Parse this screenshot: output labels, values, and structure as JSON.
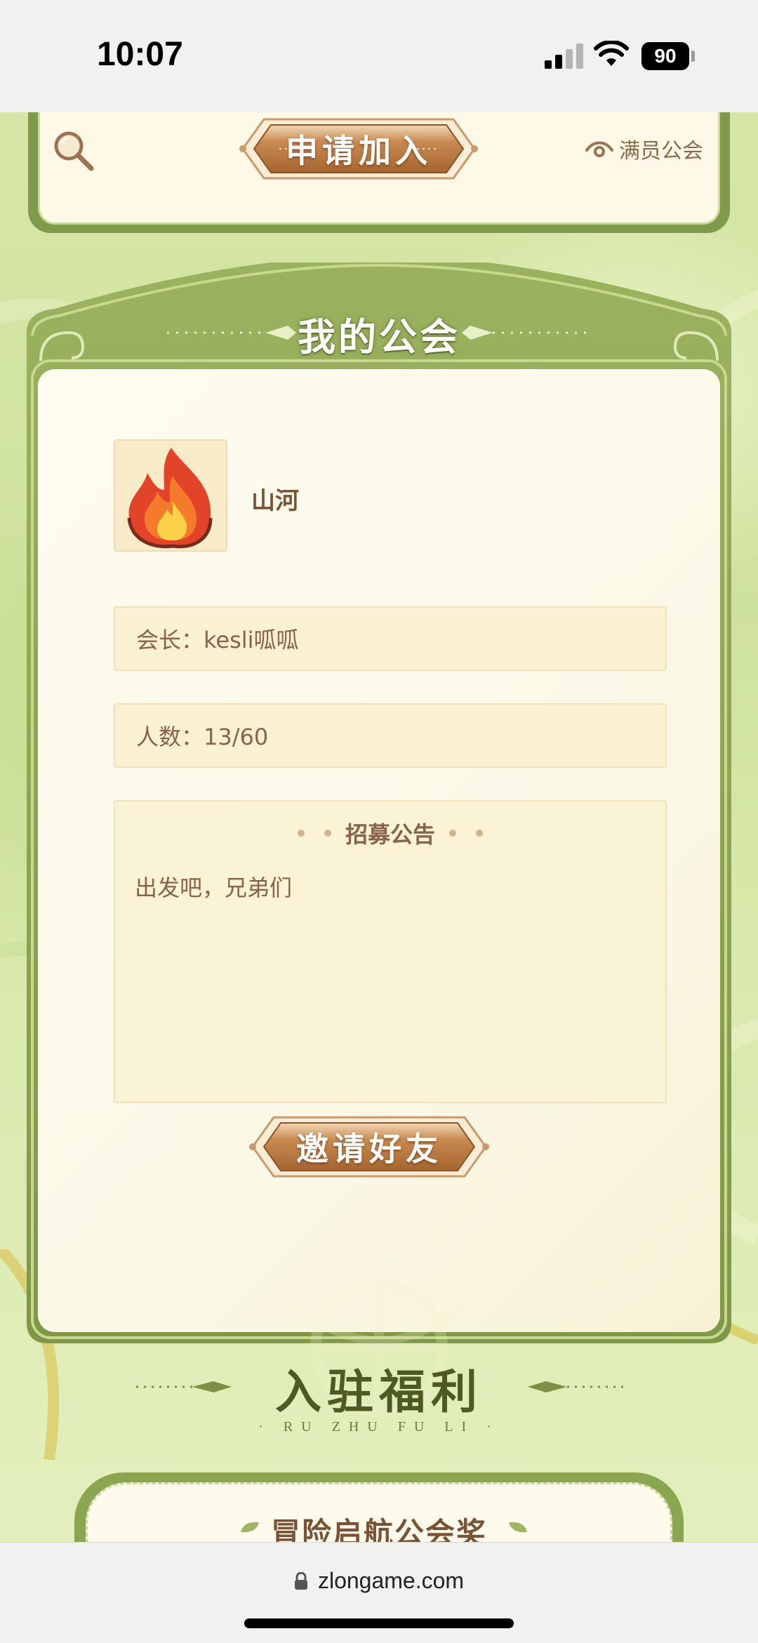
{
  "status_bar": {
    "time": "10:07",
    "battery": "90"
  },
  "top_card": {
    "apply_button": "申请加入",
    "view_full_label": "满员公会"
  },
  "my_guild": {
    "title": "我的公会",
    "avatar_icon": "fire-icon",
    "name": "山河",
    "leader": "会长：kesli呱呱",
    "member_count": "人数：13/60",
    "recruit_title": "招募公告",
    "recruit_text": "出发吧，兄弟们",
    "invite_button": "邀请好友"
  },
  "benefits": {
    "title": "入驻福利",
    "subtitle": "· RU ZHU FU LI ·",
    "reward_title": "冒险启航公会奖"
  },
  "browser": {
    "url": "zlongame.com"
  },
  "colors": {
    "frame_green": "#7f9a4a",
    "text_brown": "#8a6247",
    "button_brown": "#b8773f",
    "panel_cream": "#faf1d2"
  }
}
